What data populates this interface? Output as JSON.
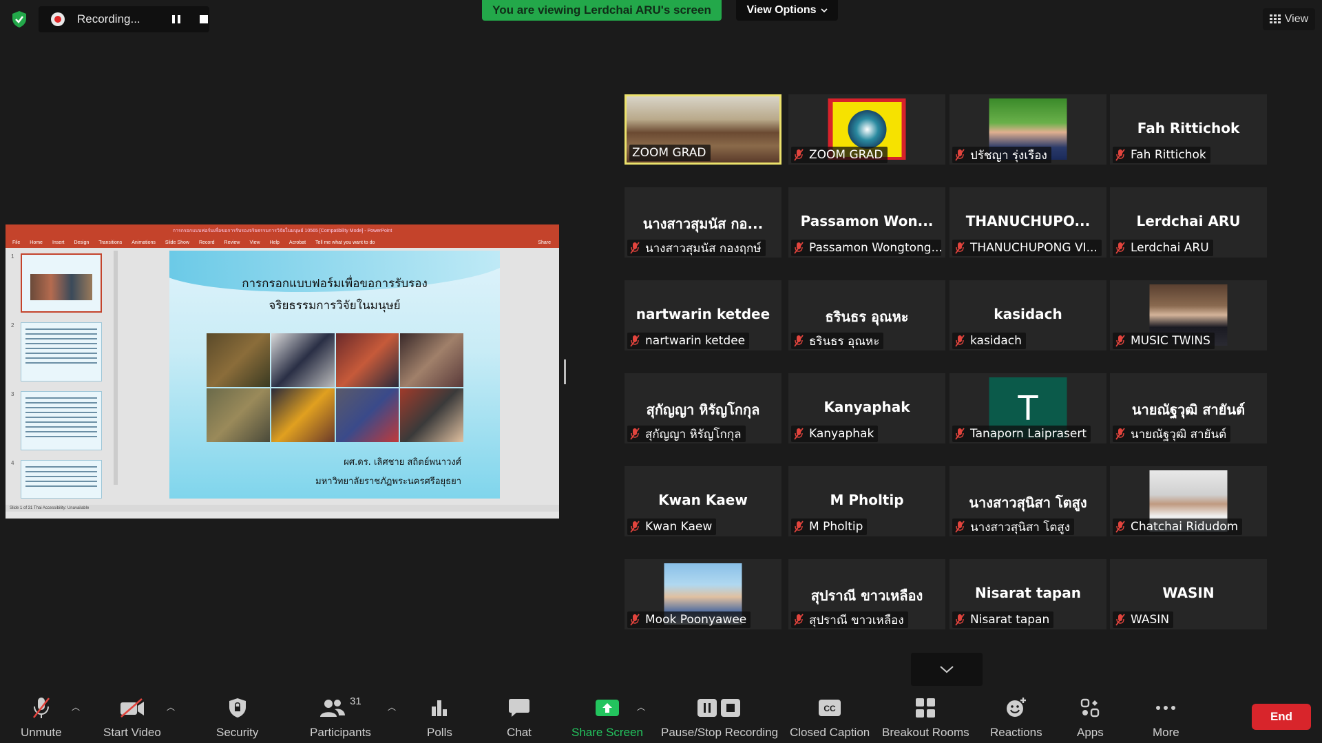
{
  "recording": {
    "status_text": "Recording..."
  },
  "banner": {
    "viewing_text": "You are viewing Lerdchai ARU's screen",
    "view_options_label": "View Options"
  },
  "view_button": {
    "label": "View"
  },
  "shared_screen": {
    "window_title": "การกรอกแบบฟอร์มเพื่อขอการรับรองจริยธรรมการวิจัยในมนุษย์ 10565 [Compatibility Mode] - PowerPoint",
    "ribbon_tabs": [
      "File",
      "Home",
      "Insert",
      "Design",
      "Transitions",
      "Animations",
      "Slide Show",
      "Record",
      "Review",
      "View",
      "Help",
      "Acrobat",
      "Tell me what you want to do"
    ],
    "share_label": "Share",
    "slide_numbers": [
      "1",
      "2",
      "3",
      "4"
    ],
    "slide_title_1": "การกรอกแบบฟอร์มเพื่อขอการรับรอง",
    "slide_title_2": "จริยธรรมการวิจัยในมนุษย์",
    "author": "ผศ.ดร. เลิศชาย สถิตย์พนาวงศ์",
    "university": "มหาวิทยาลัยราชภัฏพระนครศรีอยุธยา",
    "status_bar": "Slide 1 of 31    Thai    Accessibility: Unavailable"
  },
  "participants": [
    {
      "name": "",
      "label": "ZOOM GRAD",
      "muted": false,
      "video": "classroom",
      "active": true
    },
    {
      "name": "",
      "label": "ZOOM GRAD",
      "muted": true,
      "video": "logo"
    },
    {
      "name": "",
      "label": "ปรัชญา รุ่งเรือง",
      "muted": true,
      "video": "man"
    },
    {
      "name": "Fah Rittichok",
      "label": "Fah Rittichok",
      "muted": true
    },
    {
      "name": "นางสาวสุมนัส กอ...",
      "label": "นางสาวสุมนัส กองฤกษ์",
      "muted": true
    },
    {
      "name": "Passamon Won...",
      "label": "Passamon Wongtong...",
      "muted": true
    },
    {
      "name": "THANUCHUPO...",
      "label": "THANUCHUPONG VI...",
      "muted": true
    },
    {
      "name": "Lerdchai ARU",
      "label": "Lerdchai ARU",
      "muted": true
    },
    {
      "name": "nartwarin ketdee",
      "label": "nartwarin ketdee",
      "muted": true
    },
    {
      "name": "ธรินธร อุณหะ",
      "label": "ธรินธร อุณหะ",
      "muted": true
    },
    {
      "name": "kasidach",
      "label": "kasidach",
      "muted": true
    },
    {
      "name": "",
      "label": "MUSIC TWINS",
      "muted": true,
      "video": "twins"
    },
    {
      "name": "สุกัญญา หิรัญโกกุล",
      "label": "สุกัญญา หิรัญโกกุล",
      "muted": true
    },
    {
      "name": "Kanyaphak",
      "label": "Kanyaphak",
      "muted": true
    },
    {
      "name": "",
      "label": "Tanaporn Laiprasert",
      "muted": true,
      "video": "avatar",
      "avatar_letter": "T"
    },
    {
      "name": "นายณัฐวุฒิ สายันต์",
      "label": "นายณัฐวุฒิ สายันต์",
      "muted": true
    },
    {
      "name": "Kwan Kaew",
      "label": "Kwan Kaew",
      "muted": true
    },
    {
      "name": "M Pholtip",
      "label": "M Pholtip",
      "muted": true
    },
    {
      "name": "นางสาวสุนิสา โตสูง",
      "label": "นางสาวสุนิสา โตสูง",
      "muted": true
    },
    {
      "name": "",
      "label": "Chatchai Ridudom",
      "muted": true,
      "video": "man2"
    },
    {
      "name": "",
      "label": "Mook Poonyawee",
      "muted": true,
      "video": "woman"
    },
    {
      "name": "สุปราณี ขาวเหลือง",
      "label": "สุปราณี ขาวเหลือง",
      "muted": true
    },
    {
      "name": "Nisarat tapan",
      "label": "Nisarat tapan",
      "muted": true
    },
    {
      "name": "WASIN",
      "label": "WASIN",
      "muted": true
    }
  ],
  "toolbar": {
    "unmute": "Unmute",
    "start_video": "Start Video",
    "security": "Security",
    "participants": "Participants",
    "participants_count": "31",
    "polls": "Polls",
    "chat": "Chat",
    "share_screen": "Share Screen",
    "pause_stop_recording": "Pause/Stop Recording",
    "closed_caption": "Closed Caption",
    "breakout_rooms": "Breakout Rooms",
    "reactions": "Reactions",
    "apps": "Apps",
    "more": "More",
    "end": "End"
  },
  "colors": {
    "banner_green": "#23a84a",
    "share_green": "#23c45e",
    "end_red": "#d8252b",
    "active_border": "#ece26c",
    "muted_red": "#e2443d"
  }
}
